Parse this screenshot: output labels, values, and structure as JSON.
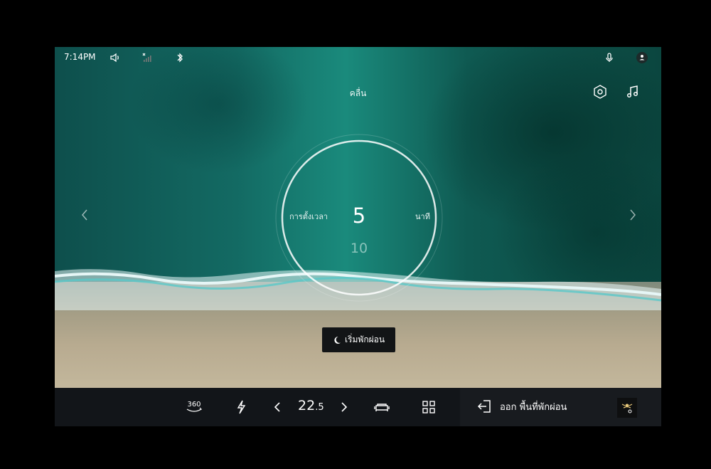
{
  "status_bar": {
    "time": "7:14PM",
    "icons": [
      "volume-low-icon",
      "cellular-off-icon",
      "bluetooth-icon",
      "microphone-icon",
      "profile-icon"
    ]
  },
  "scene": {
    "title": "คลื่น",
    "icons": [
      "settings-hexagon-icon",
      "music-note-icon",
      "chevron-left-icon",
      "chevron-right-icon"
    ]
  },
  "timer": {
    "label": "การตั้งเวลา",
    "value": "5",
    "next_value": "10",
    "unit": "นาที"
  },
  "rest_button": {
    "label": "เริ่มพักผ่อน",
    "icon": "moon-icon"
  },
  "bottom_bar": {
    "view_360_label": "360",
    "temperature_whole": "22",
    "temperature_decimal": ".5",
    "exit_label": "ออก พื้นที่พักผ่อน",
    "icons": [
      "360-view-icon",
      "charging-bolt-icon",
      "chevron-left-icon",
      "chevron-right-icon",
      "car-seat-icon",
      "apps-grid-icon",
      "exit-door-icon",
      "app-thumbnail-icon"
    ]
  },
  "colors": {
    "background": "#000000",
    "bottom_bar": "#121519",
    "button_dark": "#121416",
    "sea_teal": "#1a8a7c",
    "sand": "#b8ab90"
  }
}
